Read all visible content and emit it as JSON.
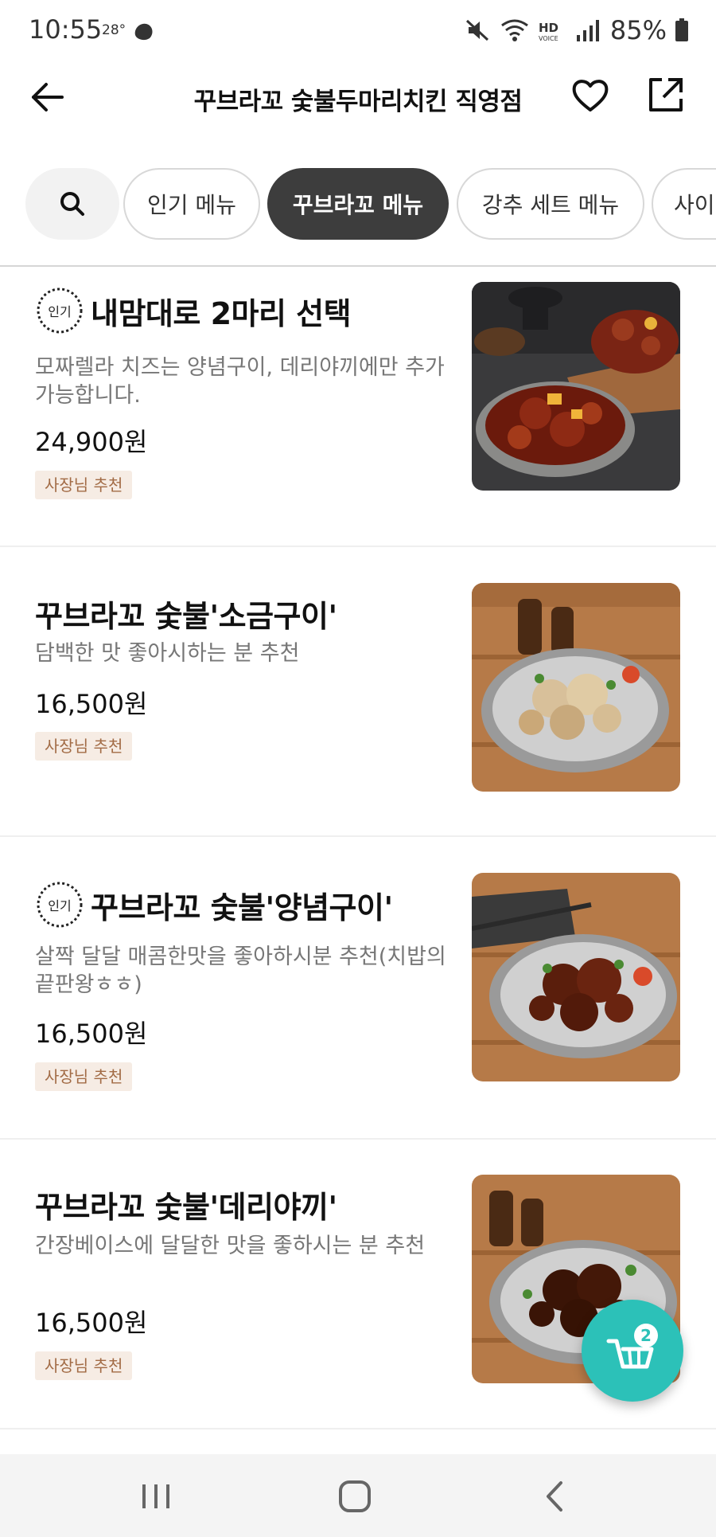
{
  "status": {
    "time": "10:55",
    "temp": "28°",
    "battery": "85%"
  },
  "header": {
    "title": "꾸브라꼬 숯불두마리치킨 직영점"
  },
  "tabs": [
    {
      "label": "인기 메뉴"
    },
    {
      "label": "꾸브라꼬 메뉴"
    },
    {
      "label": "강추 세트 메뉴"
    },
    {
      "label": "사이"
    }
  ],
  "menu": {
    "popular_badge": "인기",
    "items": [
      {
        "title": "내맘대로 2마리 선택",
        "description": "모짜렐라 치즈는 양념구이, 데리야끼에만 추가 가능합니다.",
        "price": "24,900원",
        "tag": "사장님 추천"
      },
      {
        "title": "꾸브라꼬 숯불'소금구이'",
        "description": "담백한 맛 좋아시하는 분 추천",
        "price": "16,500원",
        "tag": "사장님 추천"
      },
      {
        "title": "꾸브라꼬 숯불'양념구이'",
        "description": "살짝 달달 매콤한맛을 좋아하시분 추천(치밥의 끝판왕ㅎㅎ)",
        "price": "16,500원",
        "tag": "사장님 추천"
      },
      {
        "title": "꾸브라꼬 숯불'데리야끼'",
        "description": "간장베이스에 달달한 맛을 좋하시는 분 추천",
        "price": "16,500원",
        "tag": "사장님 추천"
      }
    ]
  },
  "cart": {
    "count": "2",
    "color": "#2cc1b8"
  },
  "colors": {
    "active_tab": "#3d3d3d",
    "tag_bg": "#f6ece4",
    "tag_text": "#a26b45"
  }
}
